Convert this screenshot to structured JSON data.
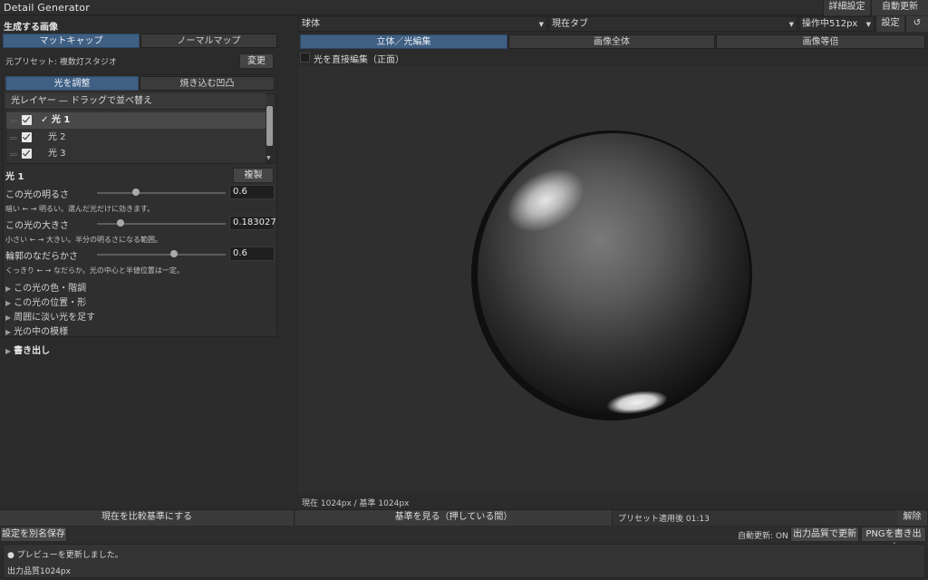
{
  "app": {
    "title": "Detail Generator"
  },
  "titlebar": {
    "advanced_settings": "詳細設定",
    "auto_update": "自動更新"
  },
  "left": {
    "section_title": "生成する画像",
    "mode_tabs": [
      {
        "label": "マットキャップ",
        "active": true
      },
      {
        "label": "ノーマルマップ",
        "active": false
      }
    ],
    "preset_label": "元プリセット: 複数灯スタジオ",
    "change_button": "変更",
    "sub_tabs": [
      {
        "label": "光を調整",
        "active": true
      },
      {
        "label": "焼き込む凹凸",
        "active": false
      }
    ],
    "layers_header": "光レイヤー — ドラッグで並べ替え",
    "layers": [
      {
        "name": "✓ 光 1",
        "checked": true,
        "selected": true
      },
      {
        "name": "光 2",
        "checked": true,
        "selected": false
      },
      {
        "name": "光 3",
        "checked": true,
        "selected": false
      }
    ],
    "light_title": "光 1",
    "duplicate_button": "複製",
    "params": [
      {
        "label": "この光の明るさ",
        "value": "0.6",
        "slider": 0.3,
        "hint": "暗い ← → 明るい。選んだ光だけに効きます。"
      },
      {
        "label": "この光の大きさ",
        "value": "0.183027",
        "slider": 0.18,
        "hint": "小さい ← → 大きい。半分の明るさになる範囲。"
      },
      {
        "label": "輪郭のなだらかさ",
        "value": "0.6",
        "slider": 0.6,
        "hint": "くっきり ← → なだらか。光の中心と半値位置は一定。"
      }
    ],
    "expanders": [
      "この光の色・階調",
      "この光の位置・形",
      "周囲に淡い光を足す",
      "光の中の模様"
    ],
    "export_section": "書き出し"
  },
  "toolbar": {
    "shape_select": "球体",
    "tab_select": "現在タブ",
    "res_select": "操作中512px",
    "settings_button": "設定",
    "reset_icon": "↺"
  },
  "view_tabs": [
    {
      "label": "立体／光編集",
      "active": true
    },
    {
      "label": "画像全体",
      "active": false
    },
    {
      "label": "画像等倍",
      "active": false
    }
  ],
  "direct_edit_label": "光を直接編集（正面）",
  "resolution_label": "現在 1024px / 基準 1024px",
  "bottom": {
    "set_baseline": "現在を比較基準にする",
    "view_baseline": "基準を見る（押している間）",
    "preset_applied": "プリセット適用後 01:13",
    "release": "解除"
  },
  "status": {
    "save_as": "設定を別名保存",
    "auto_update_state": "自動更新: ON",
    "update_quality": "出力品質で更新",
    "export_png": "PNGを書き出す"
  },
  "log": [
    "● プレビューを更新しました。",
    "出力品質1024px"
  ]
}
